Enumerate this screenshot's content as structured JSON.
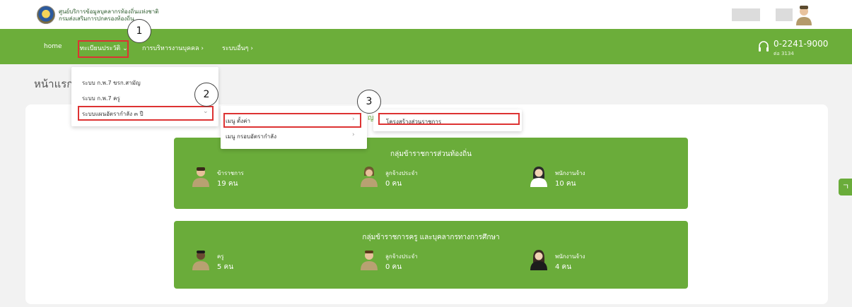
{
  "header": {
    "org_line1": "ศูนย์บริการข้อมูลบุคลากรท้องถิ่นแห่งชาติ",
    "org_line2": "กรมส่งเสริมการปกครองท้องถิ่น"
  },
  "nav": {
    "home": "home",
    "registry": "ทะเบียนประวัติ ⌄",
    "hr_admin": "การบริหารงานบุคคล ›",
    "other": "ระบบอื่นๆ ›",
    "phone": "0-2241-9000",
    "phone_ext": "ต่อ 3134"
  },
  "page_title": "หน้าแรก",
  "menu_level1": [
    "ระบบ ก.พ.7 ขรก.สามัญ",
    "ระบบ ก.พ.7 ครู",
    "ระบบแผนอัตรากำลัง ๓ ปี"
  ],
  "menu_level2": [
    "เมนู ตั้งค่า",
    "เมนู กรอบอัตรากำลัง"
  ],
  "menu_level3": [
    "โครงสร้างส่วนราชการ"
  ],
  "menu_peek": "ญ",
  "groups": [
    {
      "title": "กลุ่มข้าราชการส่วนท้องถิ่น",
      "items": [
        {
          "label": "ข้าราชการ",
          "count": "19 คน"
        },
        {
          "label": "ลูกจ้างประจำ",
          "count": "0 คน"
        },
        {
          "label": "พนักงานจ้าง",
          "count": "10 คน"
        }
      ]
    },
    {
      "title": "กลุ่มข้าราชการครู และบุคลากรทางการศึกษา",
      "items": [
        {
          "label": "ครู",
          "count": "5 คน"
        },
        {
          "label": "ลูกจ้างประจำ",
          "count": "0 คน"
        },
        {
          "label": "พนักงานจ้าง",
          "count": "4 คน"
        }
      ]
    }
  ],
  "callouts": [
    "1",
    "2",
    "3"
  ],
  "side_tab": "ㄱ",
  "colors": {
    "brand_green": "#6aac3a",
    "highlight": "#dd3333"
  }
}
